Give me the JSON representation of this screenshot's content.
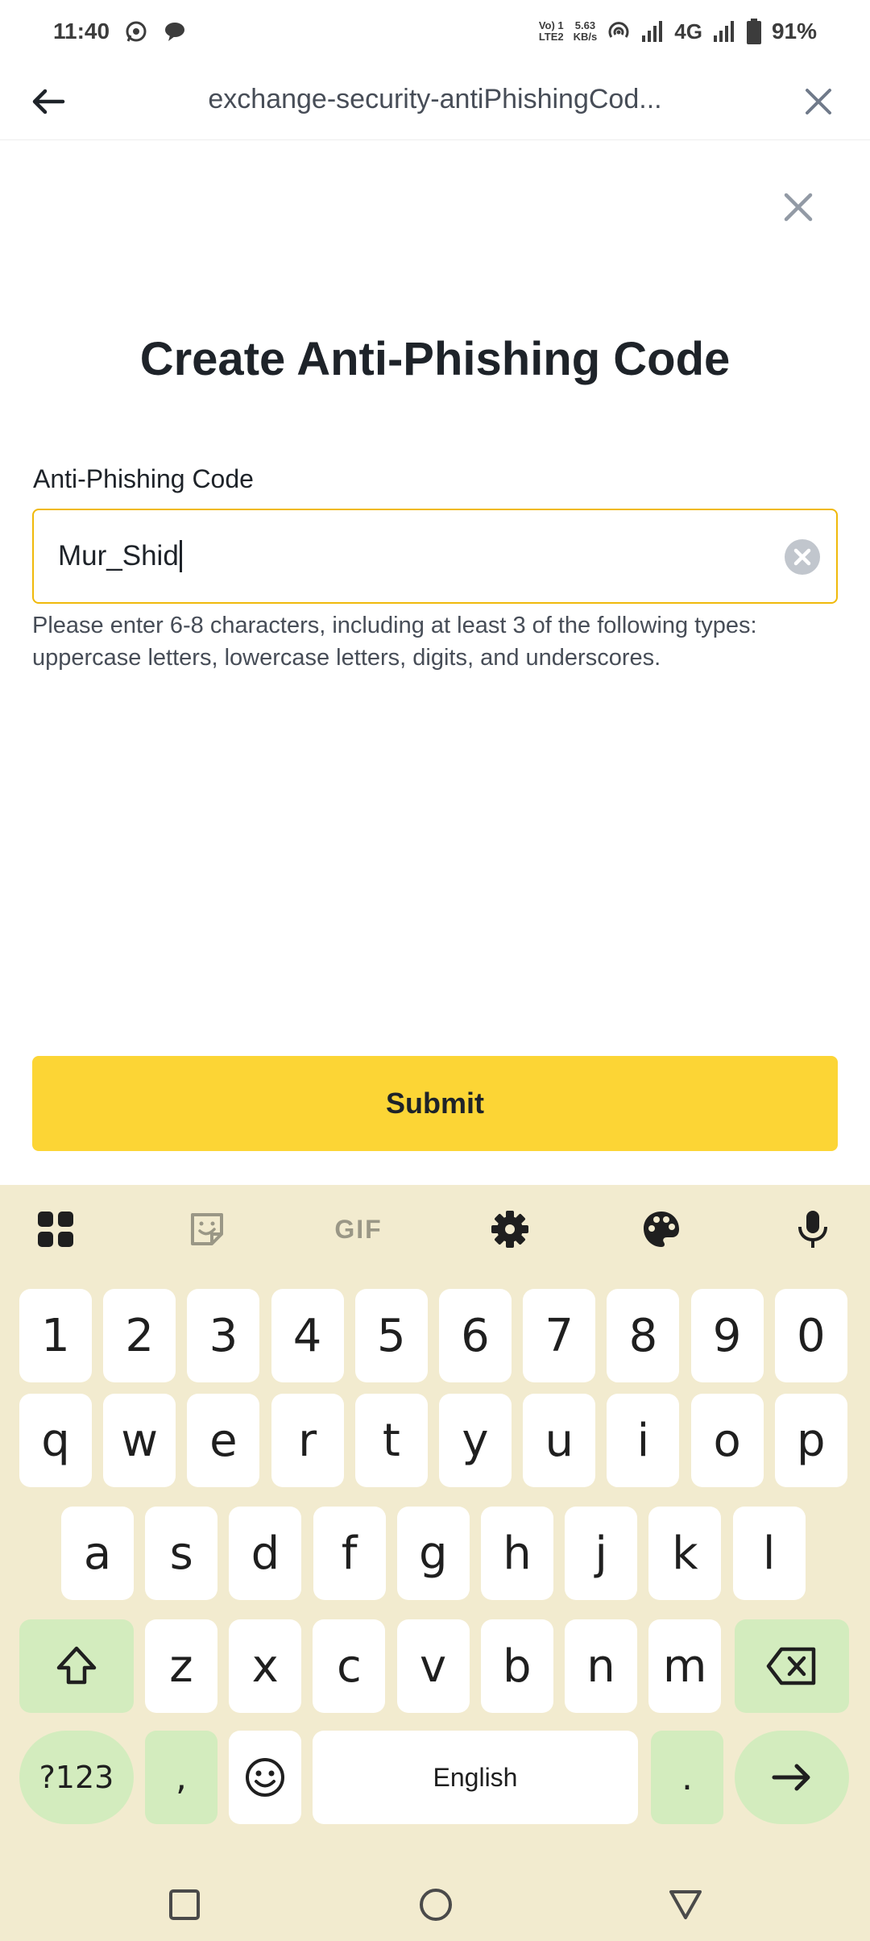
{
  "status_bar": {
    "time": "11:40",
    "network_type": "VoLTE1 LTE2",
    "net_type_line1": "Vo) 1",
    "net_type_line2": "LTE2",
    "speed_value": "5.63",
    "speed_unit": "KB/s",
    "cell_label": "4G",
    "battery": "91%",
    "icons": [
      "whatsapp-icon",
      "chat-bubble-icon",
      "hotspot-icon",
      "signal-icon",
      "signal-icon",
      "battery-icon"
    ]
  },
  "header": {
    "title": "exchange-security-antiPhishingCod...",
    "back_icon": "arrow-left-icon",
    "close_icon": "close-icon"
  },
  "form": {
    "title": "Create Anti-Phishing Code",
    "field_label": "Anti-Phishing Code",
    "input_value": "Mur_Shid",
    "hint": "Please enter 6-8 characters, including at least 3 of the following types: uppercase letters, lowercase letters, digits, and underscores.",
    "submit_label": "Submit",
    "accent_color": "#fcd535",
    "focus_color": "#f0b90b"
  },
  "keyboard": {
    "toolbar": [
      "apps-grid-icon",
      "sticker-icon",
      "GIF",
      "settings-gear-icon",
      "palette-icon",
      "microphone-icon"
    ],
    "gif_label": "GIF",
    "row_numbers": [
      "1",
      "2",
      "3",
      "4",
      "5",
      "6",
      "7",
      "8",
      "9",
      "0"
    ],
    "row1": [
      "q",
      "w",
      "e",
      "r",
      "t",
      "y",
      "u",
      "i",
      "o",
      "p"
    ],
    "row2": [
      "a",
      "s",
      "d",
      "f",
      "g",
      "h",
      "j",
      "k",
      "l"
    ],
    "row3": [
      "z",
      "x",
      "c",
      "v",
      "b",
      "n",
      "m"
    ],
    "symbols_label": "?123",
    "comma_label": ",",
    "space_label": "English",
    "period_label": ".",
    "background_color": "#f2ebcf",
    "function_key_color": "#d3ecbe"
  },
  "nav_bar": {
    "buttons": [
      "recents-square-icon",
      "home-circle-icon",
      "back-triangle-icon"
    ]
  }
}
